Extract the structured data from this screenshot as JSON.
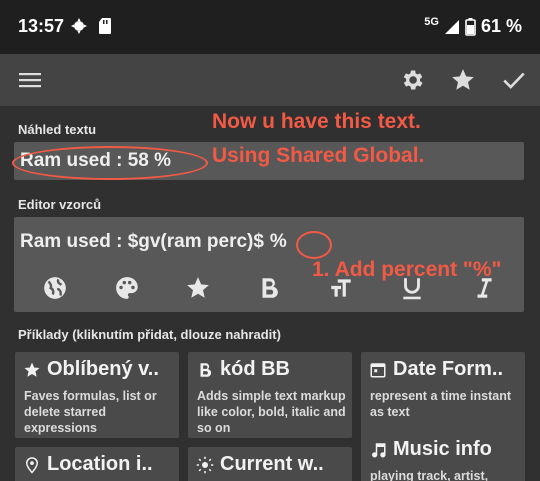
{
  "status_bar": {
    "time": "13:57",
    "network": "5G",
    "battery": "61 %"
  },
  "app_bar": {
    "icons": [
      "menu-icon",
      "gear-icon",
      "star-icon",
      "check-icon"
    ]
  },
  "preview": {
    "label": "Náhled textu",
    "text": "Ram used : 58 %"
  },
  "editor": {
    "label": "Editor vzorců",
    "text_main": "Ram used : $gv(ram perc)$",
    "text_added": "%",
    "toolbar": [
      "globe-icon",
      "palette-icon",
      "star-icon",
      "bold-icon",
      "text-size-icon",
      "underline-icon",
      "italic-icon"
    ]
  },
  "annotations": {
    "line1": "Now u have this text.",
    "line2": "Using Shared Global.",
    "step": "1. Add percent \"%\""
  },
  "examples": {
    "label": "Příklady (kliknutím přidat, dlouze nahradit)",
    "cards": [
      {
        "title": "Oblíbený v..",
        "desc": "Faves formulas, list or delete starred expressions",
        "icon": "star-icon"
      },
      {
        "title": "kód BB",
        "desc": "Adds simple text markup like color, bold, italic and so on",
        "icon": "bold-icon"
      },
      {
        "title": "Date Form..",
        "desc": "represent a time instant as text",
        "icon": "calendar-icon"
      },
      {
        "title": "Location i..",
        "desc": "",
        "icon": "location-pin-icon"
      },
      {
        "title": "Current w..",
        "desc": "",
        "icon": "sun-icon"
      },
      {
        "title": "Music info",
        "desc": "playing track, artist,",
        "icon": "music-note-icon"
      }
    ]
  },
  "colors": {
    "status_bar": "#1f1f1f",
    "app_bar": "#444444",
    "background": "#303030",
    "field": "#585858",
    "card": "#4a4a4a",
    "annotation": "#f25a45"
  }
}
